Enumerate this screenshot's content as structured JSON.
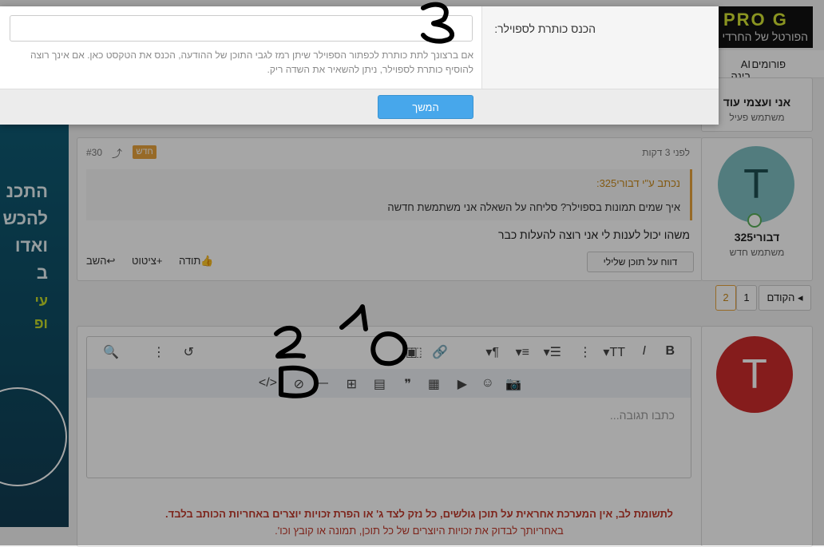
{
  "header": {
    "logo_brand": "PRO G",
    "logo_sub": "הפורטל של החרדי",
    "nav": {
      "forums": "פורומים",
      "ai": "AI בינה"
    }
  },
  "ad": {
    "line1": "התכנ",
    "line2": "להכש",
    "line3": "ואדו",
    "line4": "ב",
    "line5": "עי",
    "line6": "ופ"
  },
  "prev_user": {
    "name": "אני ועצמי עוד",
    "role": "משתמש פעיל"
  },
  "post": {
    "time": "לפני 3 דקות",
    "badge": "חדש",
    "number": "#30",
    "quote_header": "נכתב ע\"י דבורי325:",
    "quote_text": "איך שמים תמונות בספוילר? סליחה על השאלה אני משתמשת חדשה",
    "body": "משהו יכול לענות לי אני רוצה להעלות כבר",
    "report": "דווח על תוכן שלילי",
    "actions": {
      "like": "תודה",
      "quote": "ציטוט",
      "reply": "השב"
    },
    "user": {
      "initial": "T",
      "name": "דבורי325",
      "role": "משתמש חדש"
    }
  },
  "pagination": {
    "prev": "הקודם",
    "page1": "1",
    "page2": "2"
  },
  "reply_user": {
    "initial": "T"
  },
  "editor": {
    "placeholder": "כתבו תגובה..."
  },
  "notice": {
    "line1": "לתשומת לב, אין המערכת אחראית על תוכן גולשים, כל נזק לצד ג' או הפרת זכויות יוצרים באחריות הכותב בלבד.",
    "line2": "באחריותך לבדוק את זכויות היוצרים של כל תוכן, תמונה או קובץ וכו'."
  },
  "modal": {
    "label": "הכנס כותרת לספוילר:",
    "input_value": "",
    "hint": "אם ברצונך לתת כותרת לכפתור הספוילר שיתן רמז לגבי התוכן של ההודעה, הכנס את הטקסט כאן. אם אינך רוצה להוסיף כותרת לספוילר, ניתן להשאיר את השדה ריק.",
    "submit": "המשך"
  },
  "colors": {
    "accent": "#47a7eb",
    "badge": "#e8a33c",
    "avatar1": "#7fbfc2",
    "avatar2": "#cc2b2b",
    "notice": "#c0392b"
  }
}
